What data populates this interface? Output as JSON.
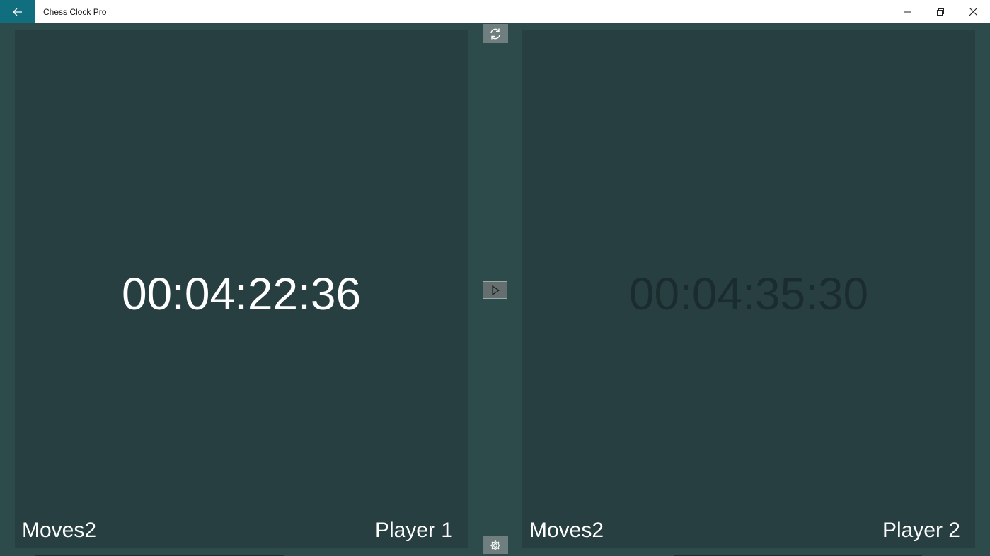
{
  "window": {
    "title": "Chess Clock Pro",
    "back_icon": "arrow-left-icon",
    "minimize_icon": "minimize-icon",
    "restore_icon": "restore-icon",
    "close_icon": "close-icon"
  },
  "controls": {
    "reset_icon": "refresh-icon",
    "play_icon": "play-icon",
    "settings_icon": "gear-icon"
  },
  "player1": {
    "time": "00:04:22:36",
    "moves_label": "Moves2",
    "name": "Player 1",
    "active": true
  },
  "player2": {
    "time": "00:04:35:30",
    "moves_label": "Moves2",
    "name": "Player 2",
    "active": false
  },
  "colors": {
    "accent": "#106e7f",
    "background": "#2d4b4b",
    "panel": "#273f41",
    "active_text": "#ffffff",
    "inactive_text": "#1b2c2e"
  }
}
